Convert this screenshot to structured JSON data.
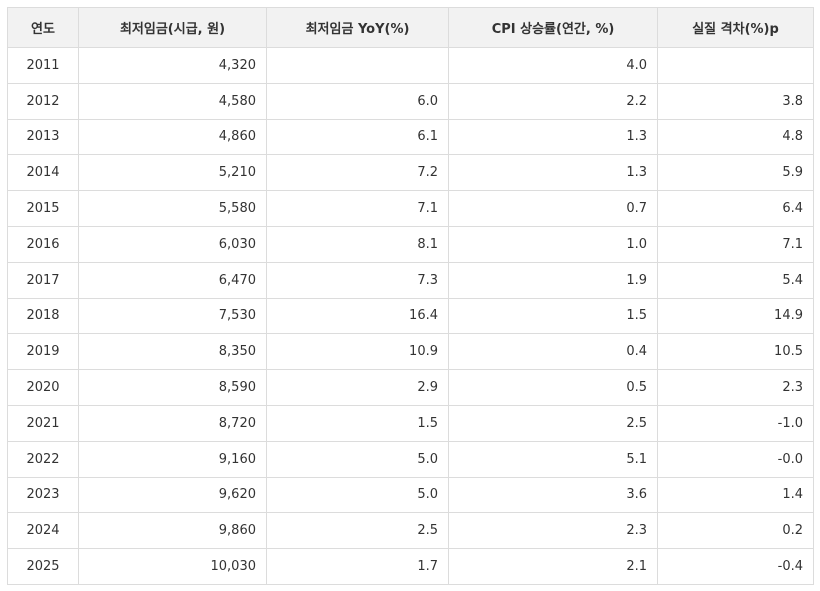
{
  "table": {
    "headers": [
      "연도",
      "최저임금(시급, 원)",
      "최저임금 YoY(%)",
      "CPI 상승률(연간, %)",
      "실질 격차(%)p"
    ],
    "rows": [
      [
        "2011",
        "4,320",
        "",
        "4.0",
        ""
      ],
      [
        "2012",
        "4,580",
        "6.0",
        "2.2",
        "3.8"
      ],
      [
        "2013",
        "4,860",
        "6.1",
        "1.3",
        "4.8"
      ],
      [
        "2014",
        "5,210",
        "7.2",
        "1.3",
        "5.9"
      ],
      [
        "2015",
        "5,580",
        "7.1",
        "0.7",
        "6.4"
      ],
      [
        "2016",
        "6,030",
        "8.1",
        "1.0",
        "7.1"
      ],
      [
        "2017",
        "6,470",
        "7.3",
        "1.9",
        "5.4"
      ],
      [
        "2018",
        "7,530",
        "16.4",
        "1.5",
        "14.9"
      ],
      [
        "2019",
        "8,350",
        "10.9",
        "0.4",
        "10.5"
      ],
      [
        "2020",
        "8,590",
        "2.9",
        "0.5",
        "2.3"
      ],
      [
        "2021",
        "8,720",
        "1.5",
        "2.5",
        "-1.0"
      ],
      [
        "2022",
        "9,160",
        "5.0",
        "5.1",
        "-0.0"
      ],
      [
        "2023",
        "9,620",
        "5.0",
        "3.6",
        "1.4"
      ],
      [
        "2024",
        "9,860",
        "2.5",
        "2.3",
        "0.2"
      ],
      [
        "2025",
        "10,030",
        "1.7",
        "2.1",
        "-0.4"
      ]
    ]
  }
}
